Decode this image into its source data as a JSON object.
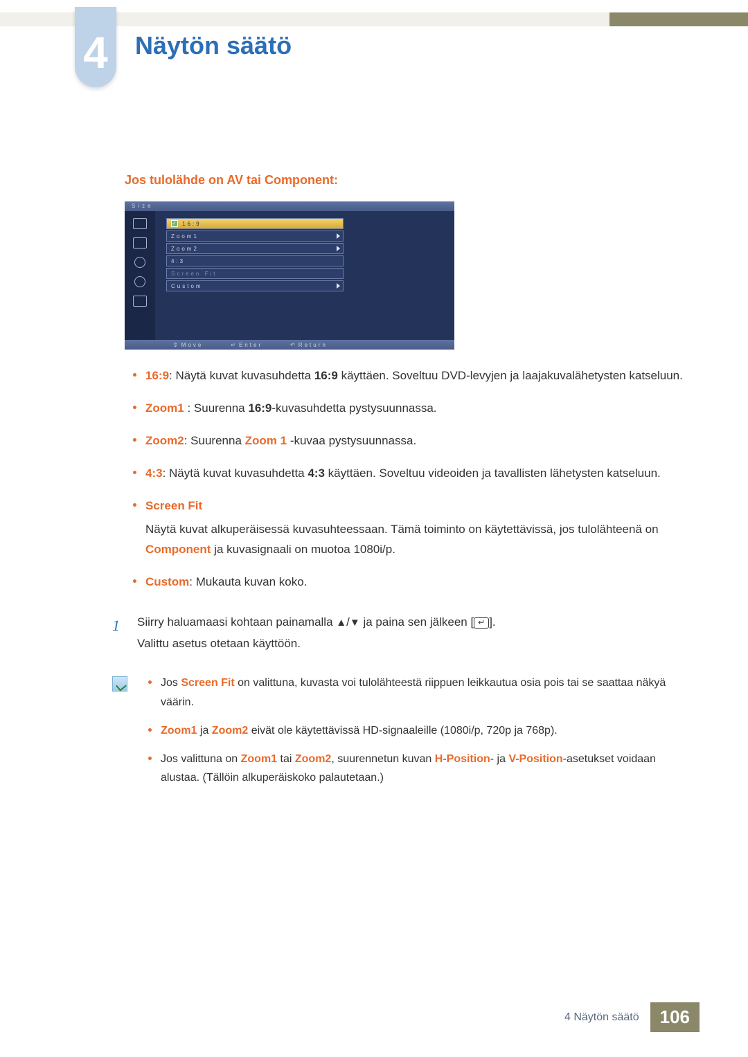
{
  "chapter": {
    "number": "4",
    "title": "Näytön säätö"
  },
  "section_heading": "Jos tulolähde on AV tai Component:",
  "osd": {
    "title": "Size",
    "items": [
      {
        "label": "16:9",
        "selected": true,
        "arrow": false,
        "checked": true
      },
      {
        "label": "Zoom1",
        "selected": false,
        "arrow": true,
        "checked": false
      },
      {
        "label": "Zoom2",
        "selected": false,
        "arrow": true,
        "checked": false
      },
      {
        "label": "4:3",
        "selected": false,
        "arrow": false,
        "checked": false
      },
      {
        "label": "Screen Fit",
        "selected": false,
        "arrow": false,
        "checked": false,
        "disabled": true
      },
      {
        "label": "Custom",
        "selected": false,
        "arrow": true,
        "checked": false
      }
    ],
    "footer": {
      "move_sym": "⇕",
      "move": "Move",
      "enter_sym": "↵",
      "enter": "Enter",
      "return_sym": "↶",
      "return": "Return"
    }
  },
  "bullets": {
    "b1_pre": "16:9",
    "b1_mid": ": Näytä kuvat kuvasuhdetta ",
    "b1_bold": "16:9",
    "b1_post": " käyttäen. Soveltuu DVD-levyjen ja laajakuvalähetysten katseluun.",
    "b2_pre": "Zoom1",
    "b2_mid": " : Suurenna ",
    "b2_bold": "16:9",
    "b2_post": "-kuvasuhdetta pystysuunnassa.",
    "b3_pre": "Zoom2",
    "b3_mid": ": Suurenna ",
    "b3_bold": "Zoom 1",
    "b3_post": " -kuvaa pystysuunnassa.",
    "b4_pre": "4:3",
    "b4_mid": ": Näytä kuvat kuvasuhdetta ",
    "b4_bold": "4:3",
    "b4_post": " käyttäen. Soveltuu videoiden ja tavallisten lähetysten katseluun.",
    "b5_title": "Screen Fit",
    "b5_line1": "Näytä kuvat alkuperäisessä kuvasuhteessaan. Tämä toiminto on käytettävissä, jos tulolähteenä on ",
    "b5_bold": "Component",
    "b5_line1_post": " ja kuvasignaali on muotoa 1080i/p.",
    "b6_pre": "Custom",
    "b6_post": ": Mukauta kuvan koko."
  },
  "step": {
    "num": "1",
    "pre": "Siirry haluamaasi kohtaan painamalla ",
    "tri_up": "▲",
    "slash": "/",
    "tri_down": "▼",
    "mid": " ja paina sen jälkeen [",
    "enter_sym": "↵",
    "post": "].",
    "line2": "Valittu asetus otetaan käyttöön."
  },
  "notes": {
    "n1_pre": "Jos ",
    "n1_bold": "Screen Fit",
    "n1_post": " on valittuna, kuvasta voi tulolähteestä riippuen leikkautua osia pois tai se saattaa näkyä väärin.",
    "n2_b1": "Zoom1",
    "n2_mid": " ja ",
    "n2_b2": "Zoom2",
    "n2_post": " eivät ole käytettävissä HD-signaaleille (1080i/p, 720p ja 768p).",
    "n3_pre": "Jos valittuna on ",
    "n3_b1": "Zoom1",
    "n3_mid1": " tai ",
    "n3_b2": "Zoom2",
    "n3_mid2": ", suurennetun kuvan ",
    "n3_b3": "H-Position",
    "n3_mid3": "- ja ",
    "n3_b4": "V-Position",
    "n3_post": "-asetukset voidaan alustaa. (Tällöin alkuperäiskoko palautetaan.)"
  },
  "footer": {
    "label": "4 Näytön säätö",
    "page": "106"
  }
}
